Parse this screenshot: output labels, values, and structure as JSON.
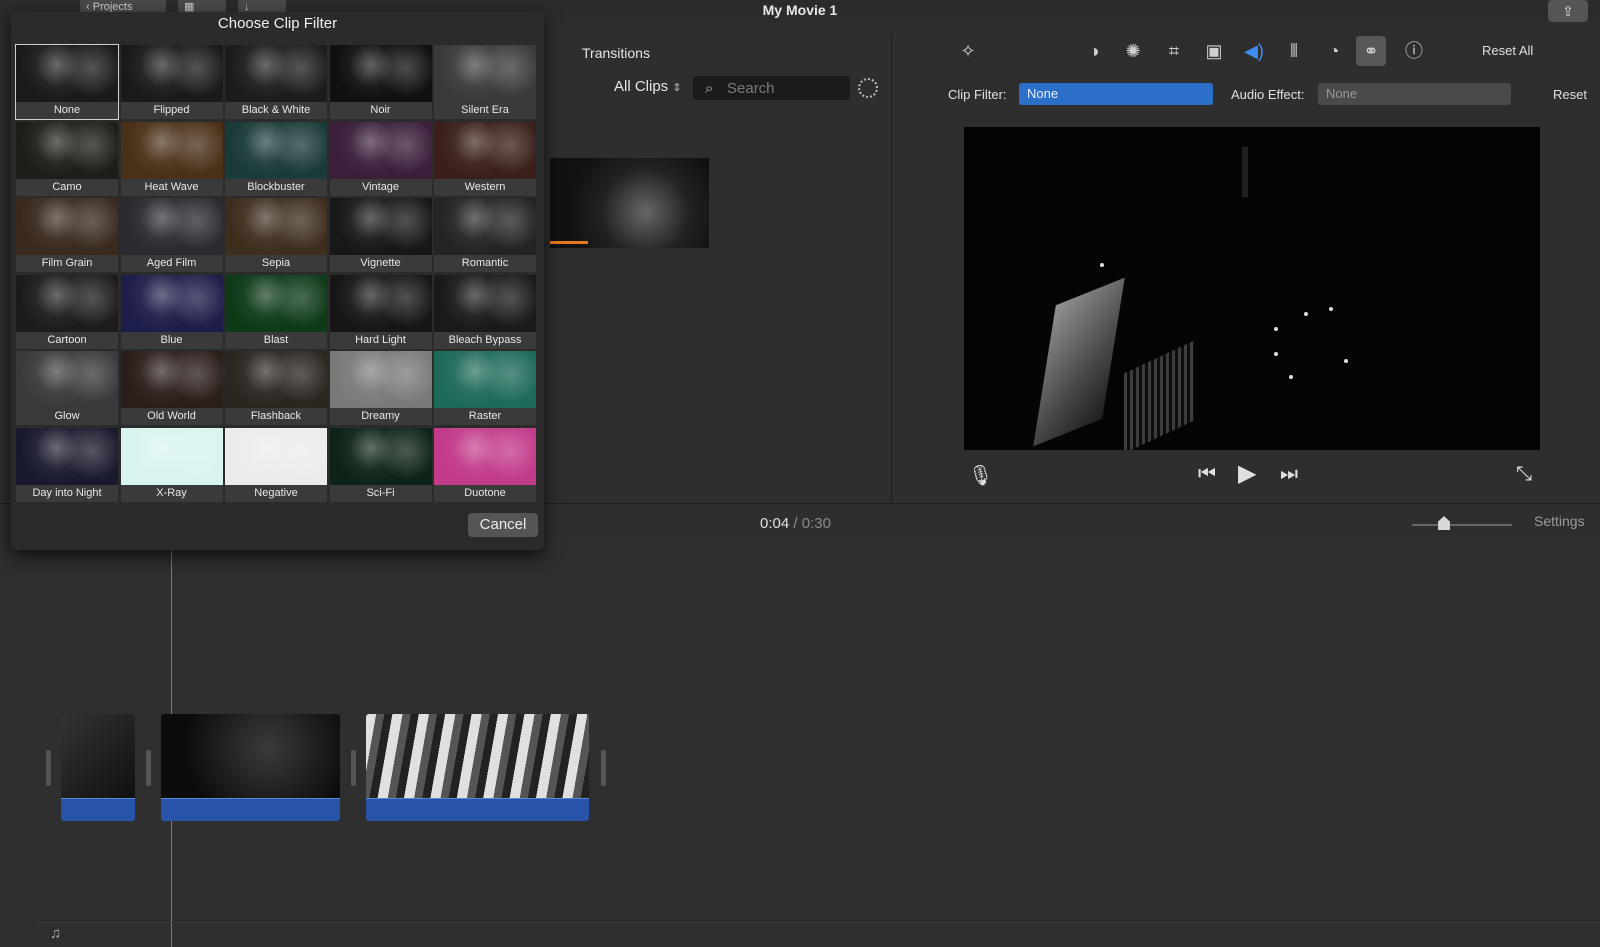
{
  "window": {
    "title": "My Movie 1",
    "projects_button": "Projects"
  },
  "browser": {
    "transitions_label": "Transitions",
    "all_clips": "All Clips",
    "search_placeholder": "Search"
  },
  "viewer": {
    "reset_all": "Reset All",
    "clip_filter_label": "Clip Filter:",
    "clip_filter_value": "None",
    "audio_effect_label": "Audio Effect:",
    "audio_effect_value": "None",
    "reset": "Reset"
  },
  "timeline": {
    "current_time": "0:04",
    "separator": "/",
    "duration": "0:30",
    "settings": "Settings"
  },
  "dialog": {
    "title": "Choose Clip Filter",
    "cancel": "Cancel",
    "selected": "None",
    "filters": [
      {
        "label": "None",
        "tint": "#1a1a1a"
      },
      {
        "label": "Flipped",
        "tint": "#1a1a1a"
      },
      {
        "label": "Black & White",
        "tint": "#1c1c1c"
      },
      {
        "label": "Noir",
        "tint": "#101010"
      },
      {
        "label": "Silent Era",
        "tint": "#3a3a3a"
      },
      {
        "label": "Camo",
        "tint": "#1e1d18"
      },
      {
        "label": "Heat Wave",
        "tint": "#4a3018"
      },
      {
        "label": "Blockbuster",
        "tint": "#1b3a3a"
      },
      {
        "label": "Vintage",
        "tint": "#3a1e3a"
      },
      {
        "label": "Western",
        "tint": "#3a1f1a"
      },
      {
        "label": "Film Grain",
        "tint": "#3a2a1e"
      },
      {
        "label": "Aged Film",
        "tint": "#2a2a30"
      },
      {
        "label": "Sepia",
        "tint": "#3e2e1e"
      },
      {
        "label": "Vignette",
        "tint": "#181818"
      },
      {
        "label": "Romantic",
        "tint": "#242424"
      },
      {
        "label": "Cartoon",
        "tint": "#1c1c1c"
      },
      {
        "label": "Blue",
        "tint": "#1e1e4a"
      },
      {
        "label": "Blast",
        "tint": "#0e3a18"
      },
      {
        "label": "Hard Light",
        "tint": "#161616"
      },
      {
        "label": "Bleach Bypass",
        "tint": "#1a1a1a"
      },
      {
        "label": "Glow",
        "tint": "#3a3a3a"
      },
      {
        "label": "Old World",
        "tint": "#2a1e1a"
      },
      {
        "label": "Flashback",
        "tint": "#2a2620"
      },
      {
        "label": "Dreamy",
        "tint": "#7a7a7a"
      },
      {
        "label": "Raster",
        "tint": "#1e6a5a"
      },
      {
        "label": "Day into Night",
        "tint": "#1a1a2e"
      },
      {
        "label": "X-Ray",
        "tint": "#d8f4f0"
      },
      {
        "label": "Negative",
        "tint": "#ececec"
      },
      {
        "label": "Sci-Fi",
        "tint": "#0e2418"
      },
      {
        "label": "Duotone",
        "tint": "#c23a8a"
      }
    ]
  },
  "colors": {
    "accent": "#2c6fc8",
    "audio_track": "#2754a8",
    "progress": "#e87a1e"
  }
}
